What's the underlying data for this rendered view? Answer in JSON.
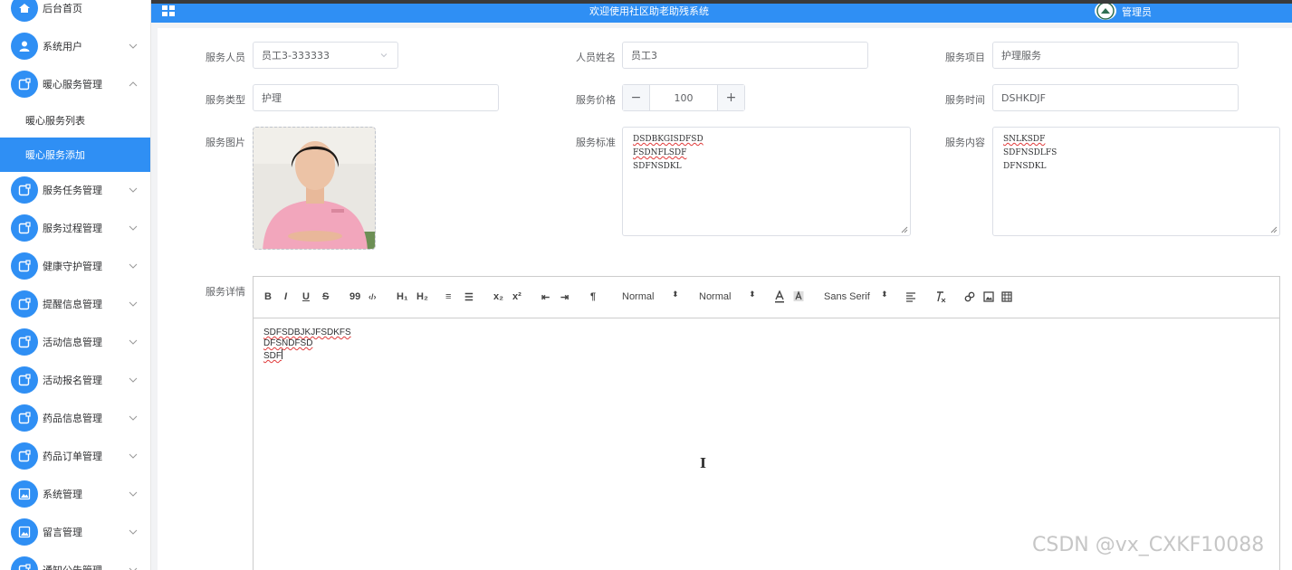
{
  "colors": {
    "primary": "#2f8ff4",
    "sidebar_bg": "#ffffff",
    "page_bg": "#f2f3f5",
    "spell_error": "#e03a3a"
  },
  "header": {
    "title": "欢迎使用社区助老助残系统",
    "user": "管理员"
  },
  "sidebar": {
    "items": [
      {
        "label": "后台首页",
        "icon": "home-icon"
      },
      {
        "label": "系统用户",
        "icon": "user-icon"
      },
      {
        "label": "暖心服务管理",
        "icon": "module-icon",
        "expanded": true
      },
      {
        "label": "服务任务管理",
        "icon": "module-icon"
      },
      {
        "label": "服务过程管理",
        "icon": "module-icon"
      },
      {
        "label": "健康守护管理",
        "icon": "module-icon"
      },
      {
        "label": "提醒信息管理",
        "icon": "module-icon"
      },
      {
        "label": "活动信息管理",
        "icon": "module-icon"
      },
      {
        "label": "活动报名管理",
        "icon": "module-icon"
      },
      {
        "label": "药品信息管理",
        "icon": "module-icon"
      },
      {
        "label": "药品订单管理",
        "icon": "module-icon"
      },
      {
        "label": "系统管理",
        "icon": "picture-icon"
      },
      {
        "label": "留言管理",
        "icon": "picture-icon"
      },
      {
        "label": "通知公告管理",
        "icon": "module-icon"
      }
    ],
    "submenu": [
      {
        "label": "暖心服务列表",
        "active": false
      },
      {
        "label": "暖心服务添加",
        "active": true
      }
    ]
  },
  "form": {
    "staff": {
      "label": "服务人员",
      "value": "员工3-333333"
    },
    "staff_name": {
      "label": "人员姓名",
      "value": "员工3"
    },
    "service_item": {
      "label": "服务项目",
      "value": "护理服务"
    },
    "service_type": {
      "label": "服务类型",
      "value": "护理"
    },
    "price": {
      "label": "服务价格",
      "value": "100",
      "minus": "−",
      "plus": "+"
    },
    "service_time": {
      "label": "服务时间",
      "value": "DSHKDJF"
    },
    "picture": {
      "label": "服务图片"
    },
    "standard": {
      "label": "服务标准",
      "lines": [
        "DSDBKGISDFSD",
        "FSDNFLSDF",
        "SDFNSDKL"
      ]
    },
    "content": {
      "label": "服务内容",
      "lines": [
        "SNLKSDF",
        "SDFNSDLFS",
        "DFNSDKL"
      ]
    },
    "detail": {
      "label": "服务详情",
      "lines": [
        "SDFSDBJKJFSDKFS",
        "DFSNDFSD",
        "SDF"
      ],
      "toolbar": {
        "bold": "B",
        "italic": "I",
        "underline": "U",
        "strike": "S",
        "quote": "99",
        "code": "‹/›",
        "h1": "H₁",
        "h2": "H₂",
        "ol": "≡",
        "ul": "☰",
        "sub": "x₂",
        "sup": "x²",
        "outdent": "⇤",
        "indent": "⇥",
        "direction": "¶",
        "size": "Normal",
        "header": "Normal",
        "font": "Sans Serif",
        "caret": "⬍"
      }
    }
  },
  "watermark": "CSDN @vx_CXKF10088"
}
